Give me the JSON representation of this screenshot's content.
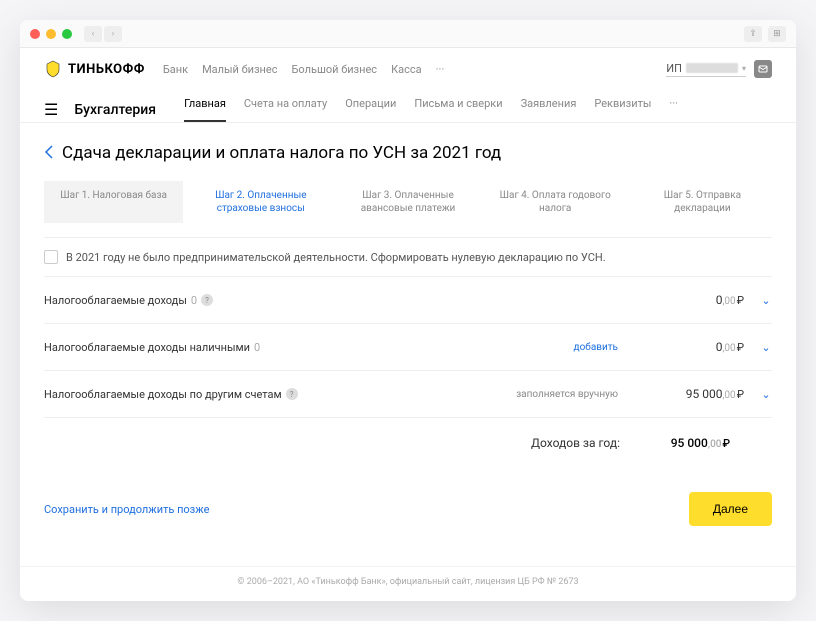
{
  "brand": "ТИНЬКОФФ",
  "top_nav": {
    "items": [
      "Банк",
      "Малый бизнес",
      "Большой бизнес",
      "Касса"
    ],
    "more": "···"
  },
  "user": {
    "prefix": "ИП"
  },
  "section": {
    "title": "Бухгалтерия",
    "tabs": [
      "Главная",
      "Счета на оплату",
      "Операции",
      "Письма и сверки",
      "Заявления",
      "Реквизиты"
    ],
    "more": "···",
    "active_index": 0
  },
  "page": {
    "title": "Сдача декларации и оплата налога по УСН за 2021 год"
  },
  "steps": [
    "Шаг 1. Налоговая база",
    "Шаг 2. Оплаченные страховые взносы",
    "Шаг 3. Оплаченные авансовые платежи",
    "Шаг 4. Оплата годового налога",
    "Шаг 5. Отправка декларации"
  ],
  "steps_active_index": 1,
  "checkbox_label": "В 2021 году не было предпринимательской деятельности. Сформировать нулевую декларацию по УСН.",
  "rows": [
    {
      "label": "Налогооблагаемые доходы",
      "count": "0",
      "has_help": true,
      "action": "",
      "note": "",
      "amount_rub": "0",
      "amount_kop": ",00",
      "expandable": true
    },
    {
      "label": "Налогооблагаемые доходы наличными",
      "count": "0",
      "has_help": false,
      "action": "добавить",
      "note": "",
      "amount_rub": "0",
      "amount_kop": ",00",
      "expandable": true
    },
    {
      "label": "Налогооблагаемые доходы по другим счетам",
      "count": "",
      "has_help": true,
      "action": "",
      "note": "заполняется вручную",
      "amount_rub": "95 000",
      "amount_kop": ",00",
      "expandable": true
    }
  ],
  "total": {
    "label": "Доходов за год:",
    "amount_rub": "95 000",
    "amount_kop": ",00"
  },
  "actions": {
    "save": "Сохранить и продолжить позже",
    "next": "Далее"
  },
  "footer": "© 2006–2021, АО «Тинькофф Банк», официальный сайт, лицензия ЦБ РФ № 2673",
  "currency_symbol": "₽"
}
